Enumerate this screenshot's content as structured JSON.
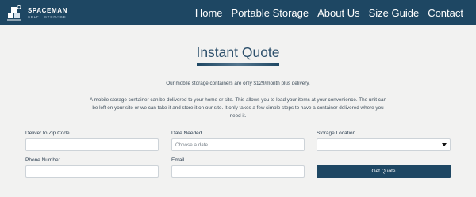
{
  "header": {
    "logo_text": "SPACEMAN",
    "logo_tag": "SELF · STORAGE",
    "nav": [
      "Home",
      "Portable Storage",
      "About Us",
      "Size Guide",
      "Contact"
    ]
  },
  "main": {
    "title": "Instant Quote",
    "intro": "Our mobile storage containers are only $129/month plus delivery.",
    "description": "A mobile storage container can be delivered to your home or site. This allows you to load your items at your convenience. The unit can be left on your site or we can take it and store it on our site. It only takes a few simple steps to have a container delivered where you need it."
  },
  "form": {
    "zip_label": "Deliver to Zip Code",
    "date_label": "Date Needed",
    "date_placeholder": "Choose a date",
    "location_label": "Storage Location",
    "phone_label": "Phone Number",
    "email_label": "Email",
    "submit_label": "Get Quote"
  },
  "colors": {
    "header_bg": "#1e4763",
    "page_bg": "#f2f2f1",
    "button_bg": "#1e4763"
  },
  "icons": {
    "logo": "astronaut-boxes-icon",
    "select": "chevron-down-icon"
  }
}
